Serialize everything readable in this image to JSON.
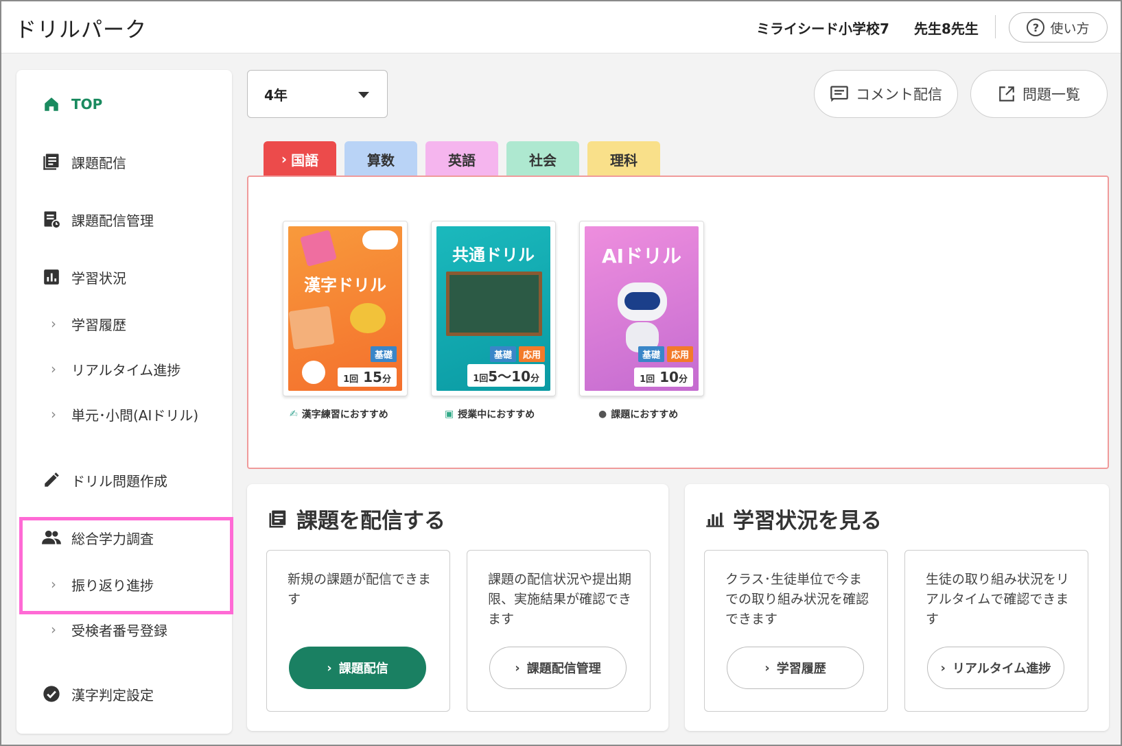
{
  "header": {
    "app_title": "ドリルパーク",
    "school": "ミライシード小学校7",
    "teacher": "先生8先生",
    "help_label": "使い方"
  },
  "sidebar": {
    "items": [
      {
        "label": "TOP",
        "icon": "home-icon",
        "active": true
      },
      {
        "label": "課題配信",
        "icon": "assignment-icon"
      },
      {
        "label": "課題配信管理",
        "icon": "assignment-manage-icon"
      },
      {
        "label": "学習状況",
        "icon": "bar-chart-icon"
      },
      {
        "label": "学習履歴",
        "icon": "chevron-right-icon"
      },
      {
        "label": "リアルタイム進捗",
        "icon": "chevron-right-icon"
      },
      {
        "label": "単元･小問(AIドリル)",
        "icon": "chevron-right-icon"
      },
      {
        "label": "ドリル問題作成",
        "icon": "pencil-icon"
      },
      {
        "label": "総合学力調査",
        "icon": "people-icon"
      },
      {
        "label": "振り返り進捗",
        "icon": "chevron-right-icon"
      },
      {
        "label": "受検者番号登録",
        "icon": "chevron-right-icon"
      },
      {
        "label": "漢字判定設定",
        "icon": "check-circle-icon"
      }
    ]
  },
  "toolbar": {
    "grade_value": "4年",
    "comment_button": "コメント配信",
    "problem_list_button": "問題一覧"
  },
  "tabs": [
    {
      "label": "国語",
      "color": "#ec4b4b",
      "active": true
    },
    {
      "label": "算数",
      "color": "#b9d3f6"
    },
    {
      "label": "英語",
      "color": "#f5b5ee"
    },
    {
      "label": "社会",
      "color": "#aee8d0"
    },
    {
      "label": "理科",
      "color": "#f9e08a"
    }
  ],
  "drills": [
    {
      "title": "漢字ドリル",
      "badges": [
        "基礎"
      ],
      "time_prefix": "1回",
      "time": "15",
      "unit": "分",
      "caption": "漢字練習におすすめ",
      "color": "#f6883a"
    },
    {
      "title": "共通ドリル",
      "badges": [
        "基礎",
        "応用"
      ],
      "time_prefix": "1回",
      "time": "5〜10",
      "unit": "分",
      "caption": "授業中におすすめ",
      "color": "#16aeb2"
    },
    {
      "title": "AIドリル",
      "badges": [
        "基礎",
        "応用"
      ],
      "time_prefix": "1回",
      "time": "10",
      "unit": "分",
      "caption": "課題におすすめ",
      "color": "#e07ad8"
    }
  ],
  "sections": [
    {
      "title": "課題を配信する",
      "cards": [
        {
          "desc": "新規の課題が配信できます",
          "button": "課題配信",
          "primary": true
        },
        {
          "desc": "課題の配信状況や提出期限、実施結果が確認できます",
          "button": "課題配信管理",
          "primary": false
        }
      ]
    },
    {
      "title": "学習状況を見る",
      "cards": [
        {
          "desc": "クラス･生徒単位で今までの取り組み状況を確認できます",
          "button": "学習履歴",
          "primary": false
        },
        {
          "desc": "生徒の取り組み状況をリアルタイムで確認できます",
          "button": "リアルタイム進捗",
          "primary": false
        }
      ]
    }
  ],
  "colors": {
    "accent_green": "#1a8062",
    "highlight_pink": "#ff6ad5",
    "panel_border": "#f09a9a"
  }
}
